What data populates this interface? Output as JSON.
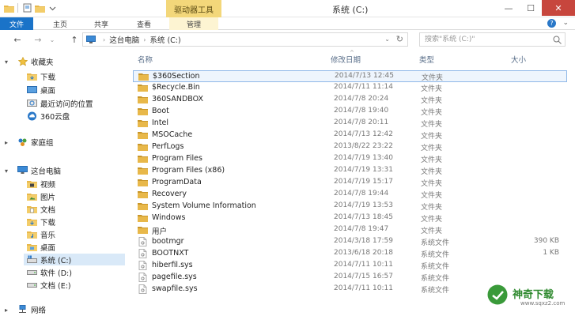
{
  "window": {
    "title": "系统 (C:)",
    "context_tab_label": "驱动器工具",
    "controls": {
      "minimize": "—",
      "maximize": "☐",
      "close": "✕"
    }
  },
  "ribbon": {
    "tabs": [
      {
        "label": "文件"
      },
      {
        "label": "主页"
      },
      {
        "label": "共享"
      },
      {
        "label": "查看"
      },
      {
        "label": "管理"
      }
    ],
    "caret": "⌄",
    "help": "?"
  },
  "address": {
    "back": "←",
    "forward": "→",
    "history": "⌄",
    "up": "↑",
    "crumbs": [
      "这台电脑",
      "系统 (C:)"
    ],
    "separator": "›",
    "dropdown": "⌄",
    "refresh": "↻",
    "search_placeholder": "搜索\"系统 (C:)\""
  },
  "nav": {
    "favorites": "收藏夹",
    "favorites_items": [
      "下载",
      "桌面",
      "最近访问的位置",
      "360云盘"
    ],
    "homegroup": "家庭组",
    "this_pc": "这台电脑",
    "pc_items": [
      "视频",
      "图片",
      "文档",
      "下载",
      "音乐",
      "桌面",
      "系统 (C:)",
      "软件 (D:)",
      "文档 (E:)"
    ],
    "network": "网络",
    "selected": "系统 (C:)"
  },
  "columns": {
    "name": "名称",
    "modified": "修改日期",
    "type": "类型",
    "size": "大小",
    "sort_caret": "^"
  },
  "files": [
    {
      "name": "$360Section",
      "date": "2014/7/13 12:45",
      "type": "文件夹",
      "size": "",
      "kind": "folder"
    },
    {
      "name": "$Recycle.Bin",
      "date": "2014/7/11 11:14",
      "type": "文件夹",
      "size": "",
      "kind": "folder"
    },
    {
      "name": "360SANDBOX",
      "date": "2014/7/8 20:24",
      "type": "文件夹",
      "size": "",
      "kind": "folder"
    },
    {
      "name": "Boot",
      "date": "2014/7/8 19:40",
      "type": "文件夹",
      "size": "",
      "kind": "folder"
    },
    {
      "name": "Intel",
      "date": "2014/7/8 20:11",
      "type": "文件夹",
      "size": "",
      "kind": "folder"
    },
    {
      "name": "MSOCache",
      "date": "2014/7/13 12:42",
      "type": "文件夹",
      "size": "",
      "kind": "folder"
    },
    {
      "name": "PerfLogs",
      "date": "2013/8/22 23:22",
      "type": "文件夹",
      "size": "",
      "kind": "folder"
    },
    {
      "name": "Program Files",
      "date": "2014/7/19 13:40",
      "type": "文件夹",
      "size": "",
      "kind": "folder"
    },
    {
      "name": "Program Files (x86)",
      "date": "2014/7/19 13:31",
      "type": "文件夹",
      "size": "",
      "kind": "folder"
    },
    {
      "name": "ProgramData",
      "date": "2014/7/19 15:17",
      "type": "文件夹",
      "size": "",
      "kind": "folder"
    },
    {
      "name": "Recovery",
      "date": "2014/7/8 19:44",
      "type": "文件夹",
      "size": "",
      "kind": "folder"
    },
    {
      "name": "System Volume Information",
      "date": "2014/7/19 13:53",
      "type": "文件夹",
      "size": "",
      "kind": "folder"
    },
    {
      "name": "Windows",
      "date": "2014/7/13 18:45",
      "type": "文件夹",
      "size": "",
      "kind": "folder"
    },
    {
      "name": "用户",
      "date": "2014/7/8 19:47",
      "type": "文件夹",
      "size": "",
      "kind": "folder"
    },
    {
      "name": "bootmgr",
      "date": "2014/3/18 17:59",
      "type": "系统文件",
      "size": "390 KB",
      "kind": "sysfile"
    },
    {
      "name": "BOOTNXT",
      "date": "2013/6/18 20:18",
      "type": "系统文件",
      "size": "1 KB",
      "kind": "sysfile"
    },
    {
      "name": "hiberfil.sys",
      "date": "2014/7/11 10:11",
      "type": "系统文件",
      "size": "",
      "kind": "sysfile"
    },
    {
      "name": "pagefile.sys",
      "date": "2014/7/15 16:57",
      "type": "系统文件",
      "size": "",
      "kind": "sysfile"
    },
    {
      "name": "swapfile.sys",
      "date": "2014/7/11 10:11",
      "type": "系统文件",
      "size": "",
      "kind": "sysfile"
    }
  ],
  "focused_row": 0,
  "watermark": {
    "text": "神奇下载",
    "url": "www.sqxz2.com"
  },
  "colors": {
    "folder": "#e8b84a",
    "folder_dark": "#c8962a",
    "accent": "#1a73c8",
    "selection": "#d9e9f8",
    "context_tab": "#f3d77a",
    "close": "#c7463d"
  }
}
